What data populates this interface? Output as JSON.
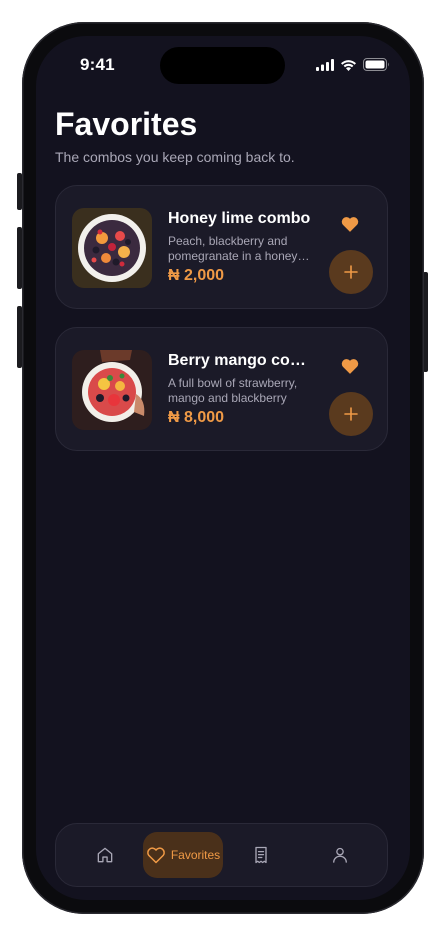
{
  "status_bar": {
    "time": "9:41"
  },
  "header": {
    "title": "Favorites",
    "subtitle": "The combos you keep coming back to."
  },
  "favorites": [
    {
      "name": "Honey lime combo",
      "description": "Peach, blackberry and pomegranate in a honey lime dressing",
      "price": "₦ 2,000"
    },
    {
      "name": "Berry mango combo",
      "description": "A full bowl of strawberry, mango and blackberry",
      "price": "₦ 8,000"
    }
  ],
  "bottom_nav": {
    "items": [
      {
        "icon": "home-icon",
        "label": ""
      },
      {
        "icon": "heart-icon",
        "label": "Favorites",
        "active": true
      },
      {
        "icon": "receipt-icon",
        "label": ""
      },
      {
        "icon": "profile-icon",
        "label": ""
      }
    ]
  },
  "colors": {
    "accent": "#f09a46",
    "background": "#13121f",
    "card": "#1b1a28"
  }
}
